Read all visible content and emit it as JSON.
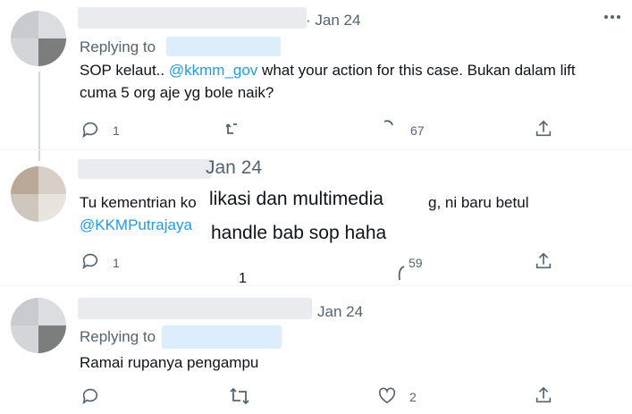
{
  "tweets": [
    {
      "date": "· Jan 24",
      "replying_label": "Replying to",
      "body_line1_before": "SOP kelaut.. ",
      "body_mention": "@kkmm_gov",
      "body_line1_after": " what your action for this case. Bukan dalam lift",
      "body_line2": "cuma 5 org aje yg bole naik?",
      "reply_count": "1",
      "like_count": "67"
    },
    {
      "date": "Jan 24",
      "body_line1": "Tu kementrian ko",
      "overlay_line1": "likasi dan multimedia",
      "body_line1_tail": "g, ni baru betul",
      "body_mention": "@KKMPutrajaya",
      "overlay_line2": "handle bab sop haha",
      "reply_count": "1",
      "like_count": "59",
      "stray_count": "1"
    },
    {
      "date": "Jan 24",
      "replying_label": "Replying to",
      "body_line1": "Ramai rupanya pengampu",
      "like_count": "2"
    }
  ]
}
